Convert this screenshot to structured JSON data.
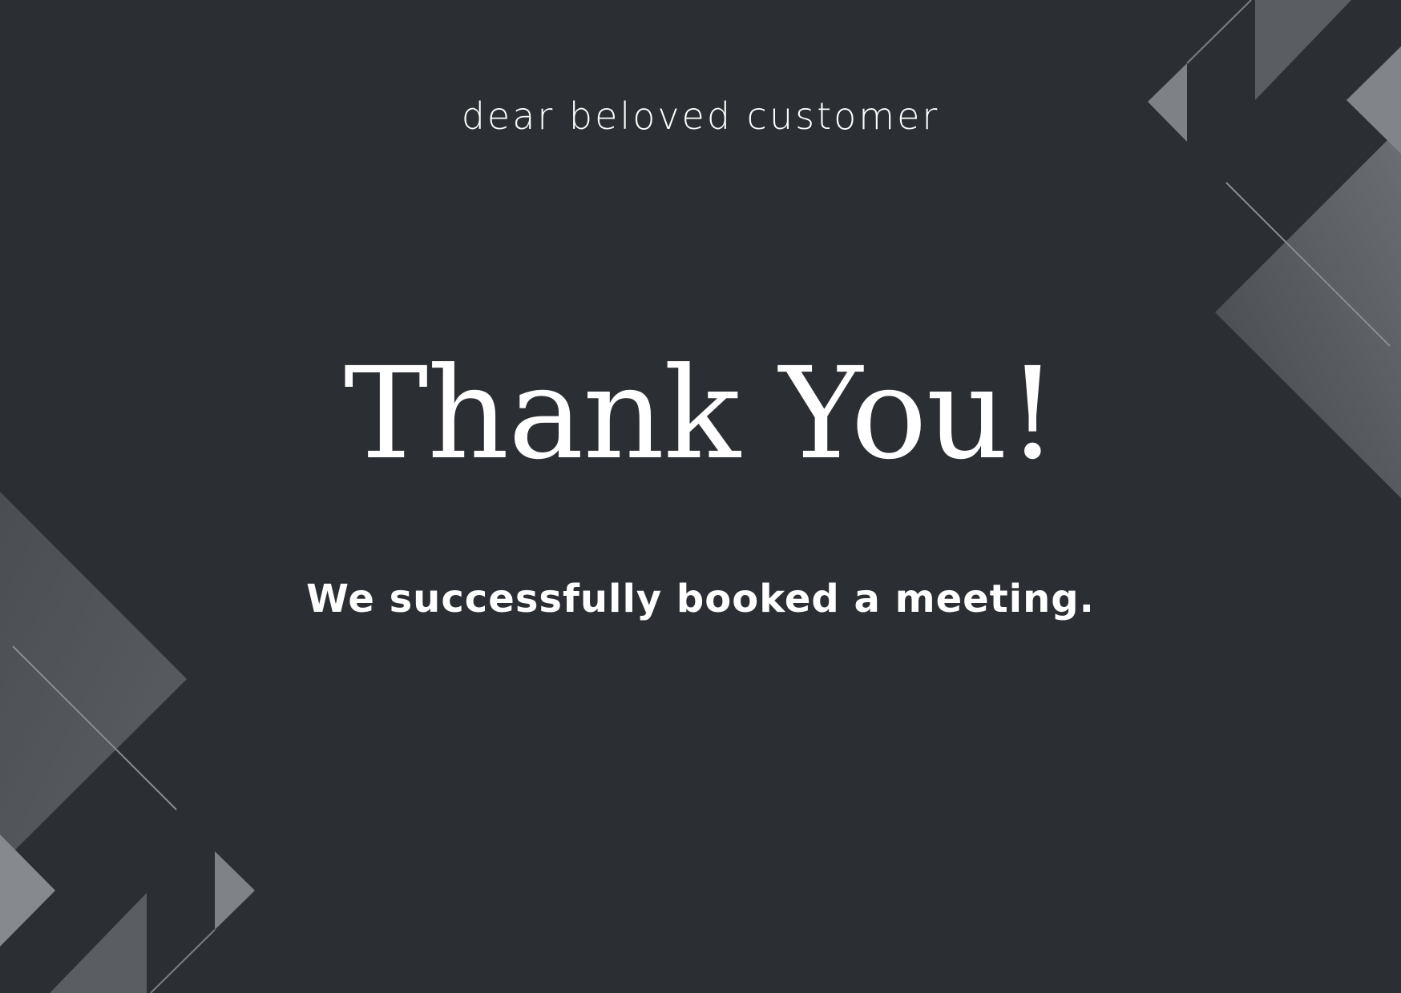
{
  "card": {
    "greeting": "dear beloved customer",
    "headline": "Thank You!",
    "message": "We successfully booked a meeting."
  },
  "colors": {
    "background": "#2b2f33",
    "text": "#ffffff",
    "shape_light": "#8a8d91",
    "shape_mid": "#5d6166",
    "shape_dark": "#474b50"
  }
}
